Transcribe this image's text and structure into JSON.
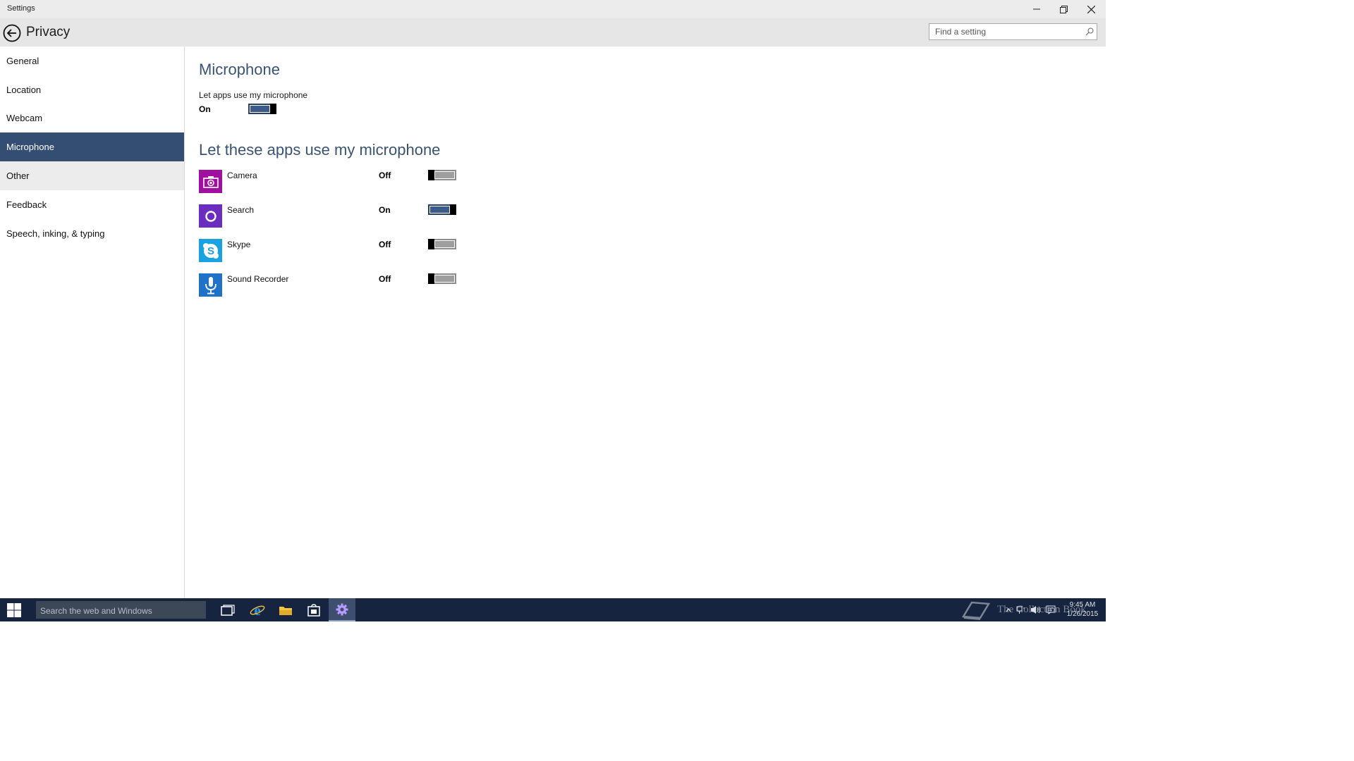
{
  "window": {
    "title": "Settings"
  },
  "header": {
    "page_title": "Privacy",
    "search_placeholder": "Find a setting"
  },
  "sidebar": {
    "items": [
      {
        "label": "General"
      },
      {
        "label": "Location"
      },
      {
        "label": "Webcam"
      },
      {
        "label": "Microphone",
        "selected": true
      },
      {
        "label": "Other"
      },
      {
        "label": "Feedback"
      },
      {
        "label": "Speech, inking, & typing"
      }
    ]
  },
  "main": {
    "section_title": "Microphone",
    "master_label": "Let apps use my microphone",
    "master_state": "On",
    "master_on": true,
    "apps_heading": "Let these apps use my microphone",
    "apps": [
      {
        "name": "Camera",
        "state": "Off",
        "on": false,
        "icon": "camera-icon",
        "color": "#a00fa0"
      },
      {
        "name": "Search",
        "state": "On",
        "on": true,
        "icon": "cortana-icon",
        "color": "#6a2fbf"
      },
      {
        "name": "Skype",
        "state": "Off",
        "on": false,
        "icon": "skype-icon",
        "color": "#1aa1e1"
      },
      {
        "name": "Sound Recorder",
        "state": "Off",
        "on": false,
        "icon": "microphone-icon",
        "color": "#1e73c8"
      }
    ]
  },
  "taskbar": {
    "search_placeholder": "Search the web and Windows",
    "watermark": "The Collection Book",
    "time": "9:45 AM",
    "date": "1/26/2015"
  },
  "colors": {
    "accent": "#344e73",
    "taskbar": "#16243f",
    "toggle_on": "#3b5b8a"
  }
}
